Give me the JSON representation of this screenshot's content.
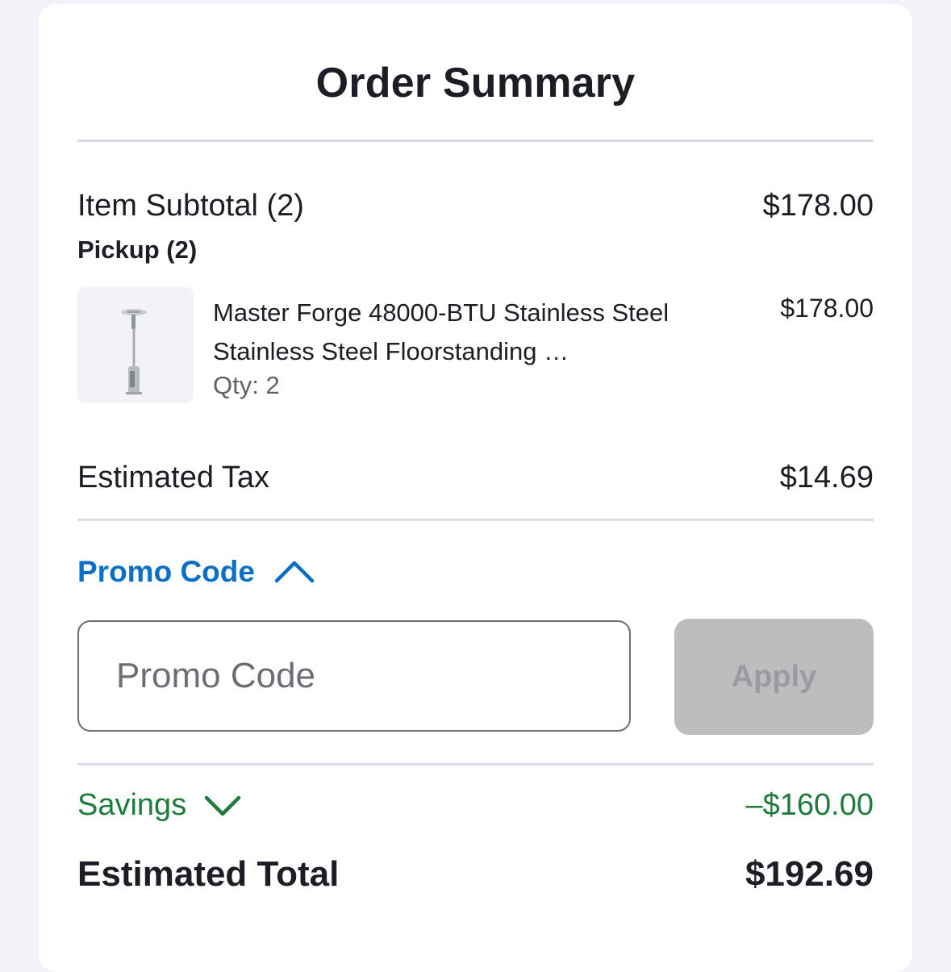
{
  "header": {
    "title": "Order Summary"
  },
  "subtotal": {
    "label": "Item Subtotal (2)",
    "value": "$178.00"
  },
  "pickup": {
    "label": "Pickup (2)"
  },
  "product": {
    "name": "Master Forge 48000-BTU Stainless Steel Stainless Steel Floorstanding …",
    "qty": "Qty: 2",
    "price": "$178.00",
    "image_icon": "patio-heater-image"
  },
  "tax": {
    "label": "Estimated Tax",
    "value": "$14.69"
  },
  "promo": {
    "toggle_label": "Promo Code",
    "toggle_icon": "chevron-up-icon",
    "input_value": "",
    "input_placeholder": "Promo Code",
    "apply_label": "Apply"
  },
  "savings": {
    "label": "Savings",
    "icon": "chevron-down-icon",
    "value": "–$160.00"
  },
  "total": {
    "label": "Estimated Total",
    "value": "$192.69"
  },
  "colors": {
    "link_blue": "#0b6fc6",
    "savings_green": "#1e7b3c",
    "disabled_button": "#bcbdbf",
    "background": "#f1f3f8"
  }
}
